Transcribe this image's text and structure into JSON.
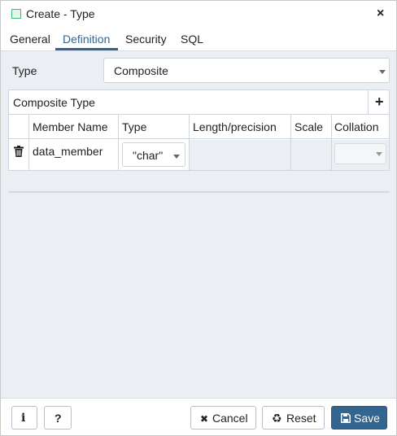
{
  "dialog": {
    "title": "Create - Type",
    "close_icon": "×"
  },
  "tabs": [
    {
      "label": "General"
    },
    {
      "label": "Definition",
      "active": true
    },
    {
      "label": "Security"
    },
    {
      "label": "SQL"
    }
  ],
  "definition": {
    "type_label": "Type",
    "type_value": "Composite",
    "composite_title": "Composite Type",
    "add_icon": "+",
    "columns": [
      "Member Name",
      "Type",
      "Length/precision",
      "Scale",
      "Collation"
    ],
    "rows": [
      {
        "member_name": "data_member",
        "type": "\"char\"",
        "length_precision": "",
        "scale": "",
        "collation": ""
      }
    ]
  },
  "footer": {
    "info_icon": "i",
    "help_icon": "?",
    "cancel_icon": "✖",
    "cancel_label": "Cancel",
    "reset_icon": "♻",
    "reset_label": "Reset",
    "save_label": "Save"
  },
  "colors": {
    "accent": "#326690",
    "panel_bg": "#ebeef3"
  }
}
